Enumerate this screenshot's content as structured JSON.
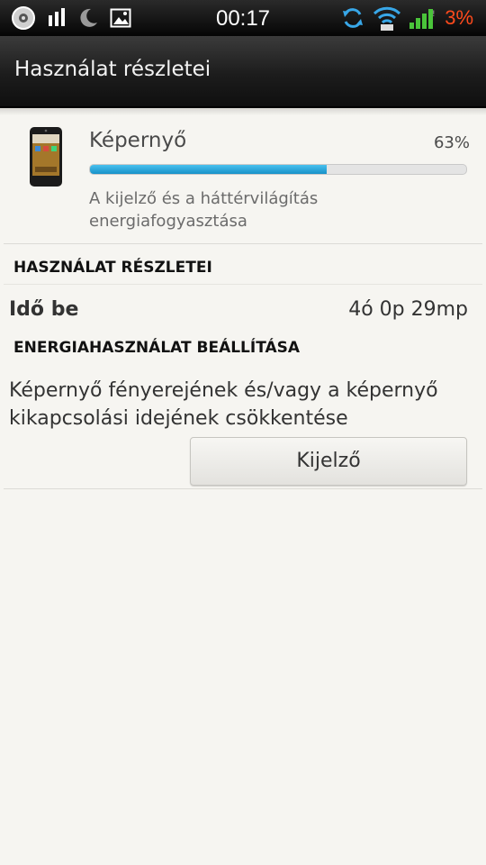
{
  "status_bar": {
    "time": "00:17",
    "battery": "3%",
    "icons": [
      "disc-icon",
      "signal-bars-icon",
      "moon-icon",
      "image-icon",
      "sync-icon",
      "wifi-icon",
      "cell-signal-icon"
    ],
    "battery_color": "#ff4a1c"
  },
  "header": {
    "title": "Használat részletei"
  },
  "usage": {
    "name": "Képernyő",
    "percent": "63%",
    "fraction": 0.63,
    "description": "A kijelző és a háttérvilágítás energiafogyasztása",
    "bar_color": "#1791c8"
  },
  "details": {
    "heading": "HASZNÁLAT RÉSZLETEI",
    "time_on_label": "Idő be",
    "time_on_value": "4ó 0p 29mp"
  },
  "settings": {
    "heading": "ENERGIAHASZNÁLAT BEÁLLÍTÁSA",
    "text": "Képernyő fényerejének és/vagy a képernyő kikapcsolási idejének csökkentése",
    "button_label": "Kijelző"
  }
}
